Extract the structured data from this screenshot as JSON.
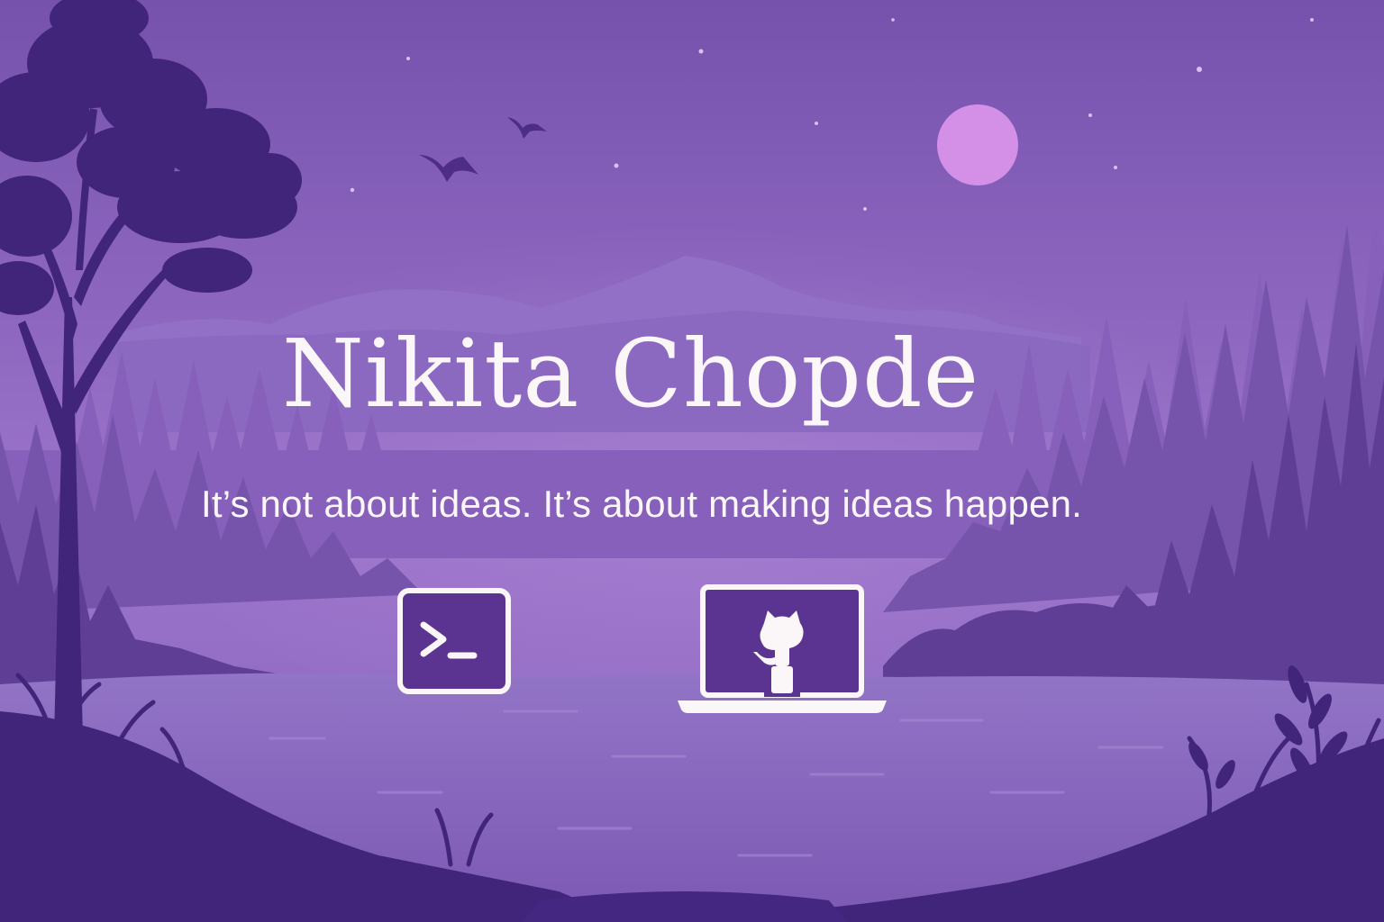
{
  "hero": {
    "name": "Nikita Chopde",
    "tagline": "It’s not about ideas. It’s about making ideas happen."
  },
  "links": [
    {
      "icon": "terminal-icon"
    },
    {
      "icon": "github-laptop-icon"
    }
  ],
  "colors": {
    "sky_top": "#7a57b0",
    "sky_bottom": "#9a72c8",
    "moon": "#d48fe6",
    "mountain": "#8a64bd",
    "forest_far": "#7d5ab2",
    "forest_near": "#5e3e93",
    "lake": "#8c69c0",
    "foreground": "#3f2470",
    "text": "#fbf6f8",
    "icon_fill": "#5a3490"
  }
}
